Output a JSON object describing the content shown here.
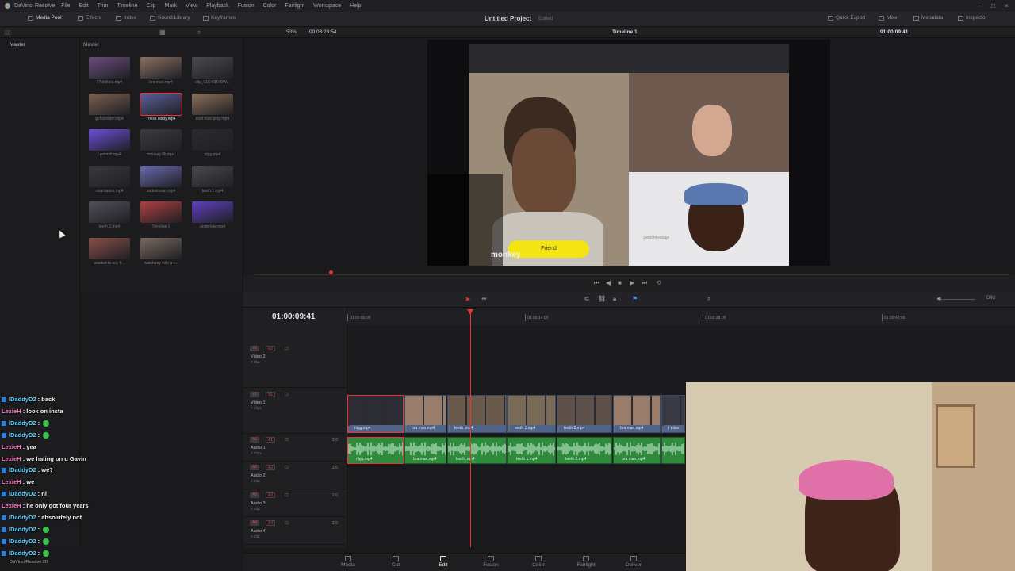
{
  "app": {
    "name": "DaVinci Resolve",
    "version_label": "DaVinci Resolve 20",
    "menu": [
      "File",
      "Edit",
      "Trim",
      "Timeline",
      "Clip",
      "Mark",
      "View",
      "Playback",
      "Fusion",
      "Color",
      "Fairlight",
      "Workspace",
      "Help"
    ]
  },
  "toolbar": {
    "left": [
      "Media Pool",
      "Effects",
      "Index",
      "Sound Library",
      "Keyframes"
    ],
    "project_title": "Untitled Project",
    "project_status": "Edited",
    "right": [
      "Quick Export",
      "Mixer",
      "Metadata",
      "Inspector"
    ]
  },
  "viewer": {
    "zoom": "53%",
    "source_timecode": "00:03:28:54",
    "timeline_name": "Timeline 1",
    "record_timecode": "01:00:09:41"
  },
  "bins": {
    "master_label": "Master"
  },
  "media_pool": {
    "label": "Master",
    "clips": [
      {
        "name": "77 dollars.mp4",
        "selected": false,
        "color": "#6a4e7a"
      },
      {
        "name": "bra man.mp4",
        "selected": false,
        "color": "#8a7060"
      },
      {
        "name": "clip_01K46BVDW...",
        "selected": false,
        "color": "#4a4a50"
      },
      {
        "name": "girl scream.mp4",
        "selected": false,
        "color": "#7a6050"
      },
      {
        "name": "i miss diddy.mp4",
        "selected": true,
        "color": "#5a5f9a"
      },
      {
        "name": "kool man ping.mp4",
        "selected": false,
        "color": "#8a7058"
      },
      {
        "name": "j wemoti.mp4",
        "selected": false,
        "color": "#6b4fd8"
      },
      {
        "name": "monkey 8k.mp4",
        "selected": false,
        "color": "#3a3a40"
      },
      {
        "name": "nigg.mp4",
        "selected": false,
        "color": "#2a2a30"
      },
      {
        "name": "retardation.mp4",
        "selected": false,
        "color": "#3a3a3e"
      },
      {
        "name": "sadevissan.mp4",
        "selected": false,
        "color": "#6a6ab0"
      },
      {
        "name": "teeth 1.mp4",
        "selected": false,
        "color": "#4a4a4e"
      },
      {
        "name": "teeth 2.mp4",
        "selected": false,
        "color": "#505058"
      },
      {
        "name": "Timeline 1",
        "selected": false,
        "color": "#b04040"
      },
      {
        "name": "undertale.mp4",
        "selected": false,
        "color": "#6040c0"
      },
      {
        "name": "wanted to say fr...",
        "selected": false,
        "color": "#8a5048"
      },
      {
        "name": "watch my wife a r...",
        "selected": false,
        "color": "#7a6a60"
      }
    ]
  },
  "preview": {
    "friend_button": "Friend",
    "send_message": "Send Message",
    "brand": "monkey"
  },
  "timeline": {
    "current_timecode": "01:00:09:41",
    "ruler": [
      "01:00:00:00",
      "01:00:14:00",
      "01:00:28:00",
      "01:00:42:00"
    ],
    "tracks": [
      {
        "id": "V2",
        "name": "Video 2",
        "sub": "0 Clip"
      },
      {
        "id": "V1",
        "name": "Video 1",
        "sub": "7 Clips"
      },
      {
        "id": "A1",
        "name": "Audio 1",
        "sub": "7 Clips",
        "level": "2.0"
      },
      {
        "id": "A2",
        "name": "Audio 2",
        "sub": "0 Clip",
        "level": "2.0"
      },
      {
        "id": "A3",
        "name": "Audio 3",
        "sub": "0 Clip",
        "level": "2.0"
      },
      {
        "id": "A4",
        "name": "Audio 4",
        "sub": "0 Clip",
        "level": "2.0"
      }
    ],
    "video_clips": [
      {
        "name": "nigg.mp4",
        "color": "#2c2c34"
      },
      {
        "name": "bra man.mp4",
        "color": "#9a7c6a"
      },
      {
        "name": "teeth .mp4",
        "color": "#6a5a4c"
      },
      {
        "name": "teeth 1.mp4",
        "color": "#7a6a58"
      },
      {
        "name": "teeth 2.mp4",
        "color": "#5c5048"
      },
      {
        "name": "bra man.mp4",
        "color": "#9a7c6a"
      },
      {
        "name": "I miss",
        "color": "#3a3a44"
      }
    ],
    "audio_clips": [
      {
        "name": "nigg.mp4"
      },
      {
        "name": "bra man.mp4"
      },
      {
        "name": "teeth .mp4"
      },
      {
        "name": "teeth 1.mp4"
      },
      {
        "name": "teeth 2.mp4"
      },
      {
        "name": "bra man.mp4"
      },
      {
        "name": ""
      }
    ]
  },
  "pages": [
    "Media",
    "Cut",
    "Edit",
    "Fusion",
    "Color",
    "Fairlight",
    "Deliver"
  ],
  "active_page": "Edit",
  "chat": [
    {
      "user": "lDaddyD2",
      "text": "back",
      "pink": false
    },
    {
      "user": "LexieH",
      "text": "look on insta",
      "pink": true
    },
    {
      "user": "lDaddyD2",
      "text": "",
      "emoji": true,
      "pink": false
    },
    {
      "user": "lDaddyD2",
      "text": "",
      "emoji": true,
      "pink": false
    },
    {
      "user": "LexieH",
      "text": "yea",
      "pink": true
    },
    {
      "user": "LexieH",
      "text": "we hating on u Gavin",
      "pink": true
    },
    {
      "user": "lDaddyD2",
      "text": "we?",
      "pink": false
    },
    {
      "user": "LexieH",
      "text": "we",
      "pink": true
    },
    {
      "user": "lDaddyD2",
      "text": "nl",
      "pink": false
    },
    {
      "user": "LexieH",
      "text": "he only got four years",
      "pink": true
    },
    {
      "user": "lDaddyD2",
      "text": "absolutely not",
      "pink": false
    },
    {
      "user": "lDaddyD2",
      "text": "",
      "emoji": true,
      "pink": false
    },
    {
      "user": "lDaddyD2",
      "text": "",
      "emoji": true,
      "pink": false
    },
    {
      "user": "lDaddyD2",
      "text": "",
      "emoji": true,
      "pink": false
    }
  ]
}
